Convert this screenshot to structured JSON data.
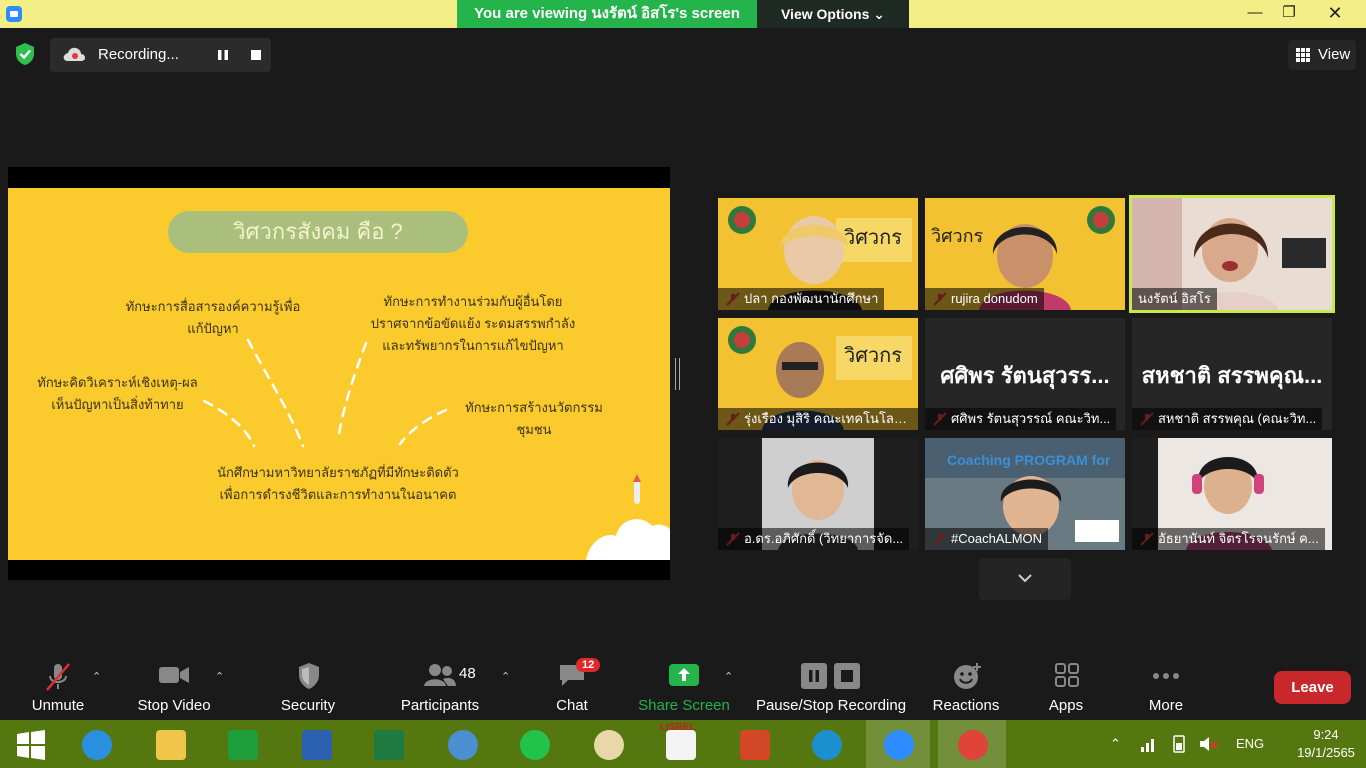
{
  "titlebar": {
    "viewing_text": "You are viewing นงรัตน์ อิสโร's screen",
    "view_options": "View Options"
  },
  "recording": {
    "status": "Recording..."
  },
  "view_button": {
    "label": "View"
  },
  "slide": {
    "title": "วิศวกรสังคม คือ ?",
    "skill_communication": "ทักษะการสื่อสารองค์ความรู้เพื่อ\nแก้ปัญหา",
    "skill_teamwork": "ทักษะการทำงานร่วมกับผู้อื่นโดย\nปราศจากข้อขัดแย้ง ระดมสรรพกำลัง\nและทรัพยากรในการแก้ไขปัญหา",
    "skill_analysis": "ทักษะคิดวิเคราะห์เชิงเหตุ-ผล\nเห็นปัญหาเป็นสิ่งท้าทาย",
    "skill_innovation": "ทักษะการสร้างนวัตกรรมชุมชน",
    "conclusion": "นักศึกษามหาวิทยาลัยราชภัฏที่มีทักษะติดตัว\nเพื่อการดำรงชีวิตและการทำงานในอนาคต"
  },
  "participants": [
    {
      "name": "ปลา กองพัฒนานักศึกษา",
      "muted": true,
      "bg": "yellow"
    },
    {
      "name": "rujira donudom",
      "muted": true,
      "bg": "yellow"
    },
    {
      "name": "นงรัตน์ อิสโร",
      "muted": false,
      "bg": "room",
      "active": true
    },
    {
      "name": "รุ่งเรือง มุสิริ คณะเทคโนโลยี...",
      "muted": true,
      "bg": "yellow"
    },
    {
      "name": "ศศิพร รัตนสุวรรณ์ คณะวิท...",
      "big": "ศศิพร รัตนสุวรร...",
      "muted": true,
      "bg": "dark"
    },
    {
      "name": "สหชาติ สรรพคุณ (คณะวิท...",
      "big": "สหชาติ สรรพคุณ...",
      "muted": true,
      "bg": "dark"
    },
    {
      "name": "อ.ดร.อภิศักดิ์ (วิทยาการจัด...",
      "muted": true,
      "bg": "gray"
    },
    {
      "name": "#CoachALMON",
      "muted": true,
      "bg": "coach",
      "overlay": "Coaching PROGRAM for"
    },
    {
      "name": "อัธยานันท์ จิตรโรจนรักษ์ ค...",
      "muted": true,
      "bg": "white"
    }
  ],
  "toolbar": {
    "unmute": "Unmute",
    "stop_video": "Stop Video",
    "security": "Security",
    "participants": "Participants",
    "participants_count": "48",
    "chat": "Chat",
    "chat_badge": "12",
    "share_screen": "Share Screen",
    "pause_stop_recording": "Pause/Stop Recording",
    "reactions": "Reactions",
    "apps": "Apps",
    "more": "More",
    "leave": "Leave"
  },
  "taskbar": {
    "apps": [
      "start-icon",
      "edge-legacy-icon",
      "file-explorer-icon",
      "store-icon",
      "word-icon",
      "excel-icon",
      "calculator-icon",
      "line-icon",
      "paint-icon",
      "lisrel-icon",
      "powerpoint-icon",
      "edge-icon",
      "zoom-icon",
      "chrome-icon"
    ],
    "lisrel_label": "LISREL",
    "language": "ENG",
    "time": "9:24",
    "date": "19/1/2565"
  },
  "colors": {
    "zoom_green": "#25b34b",
    "slide_yellow": "#fbca2d",
    "pill_green": "#a9bf7b",
    "leave_red": "#c8282b",
    "taskbar": "#54780f",
    "active_outline": "#c8e84b"
  }
}
